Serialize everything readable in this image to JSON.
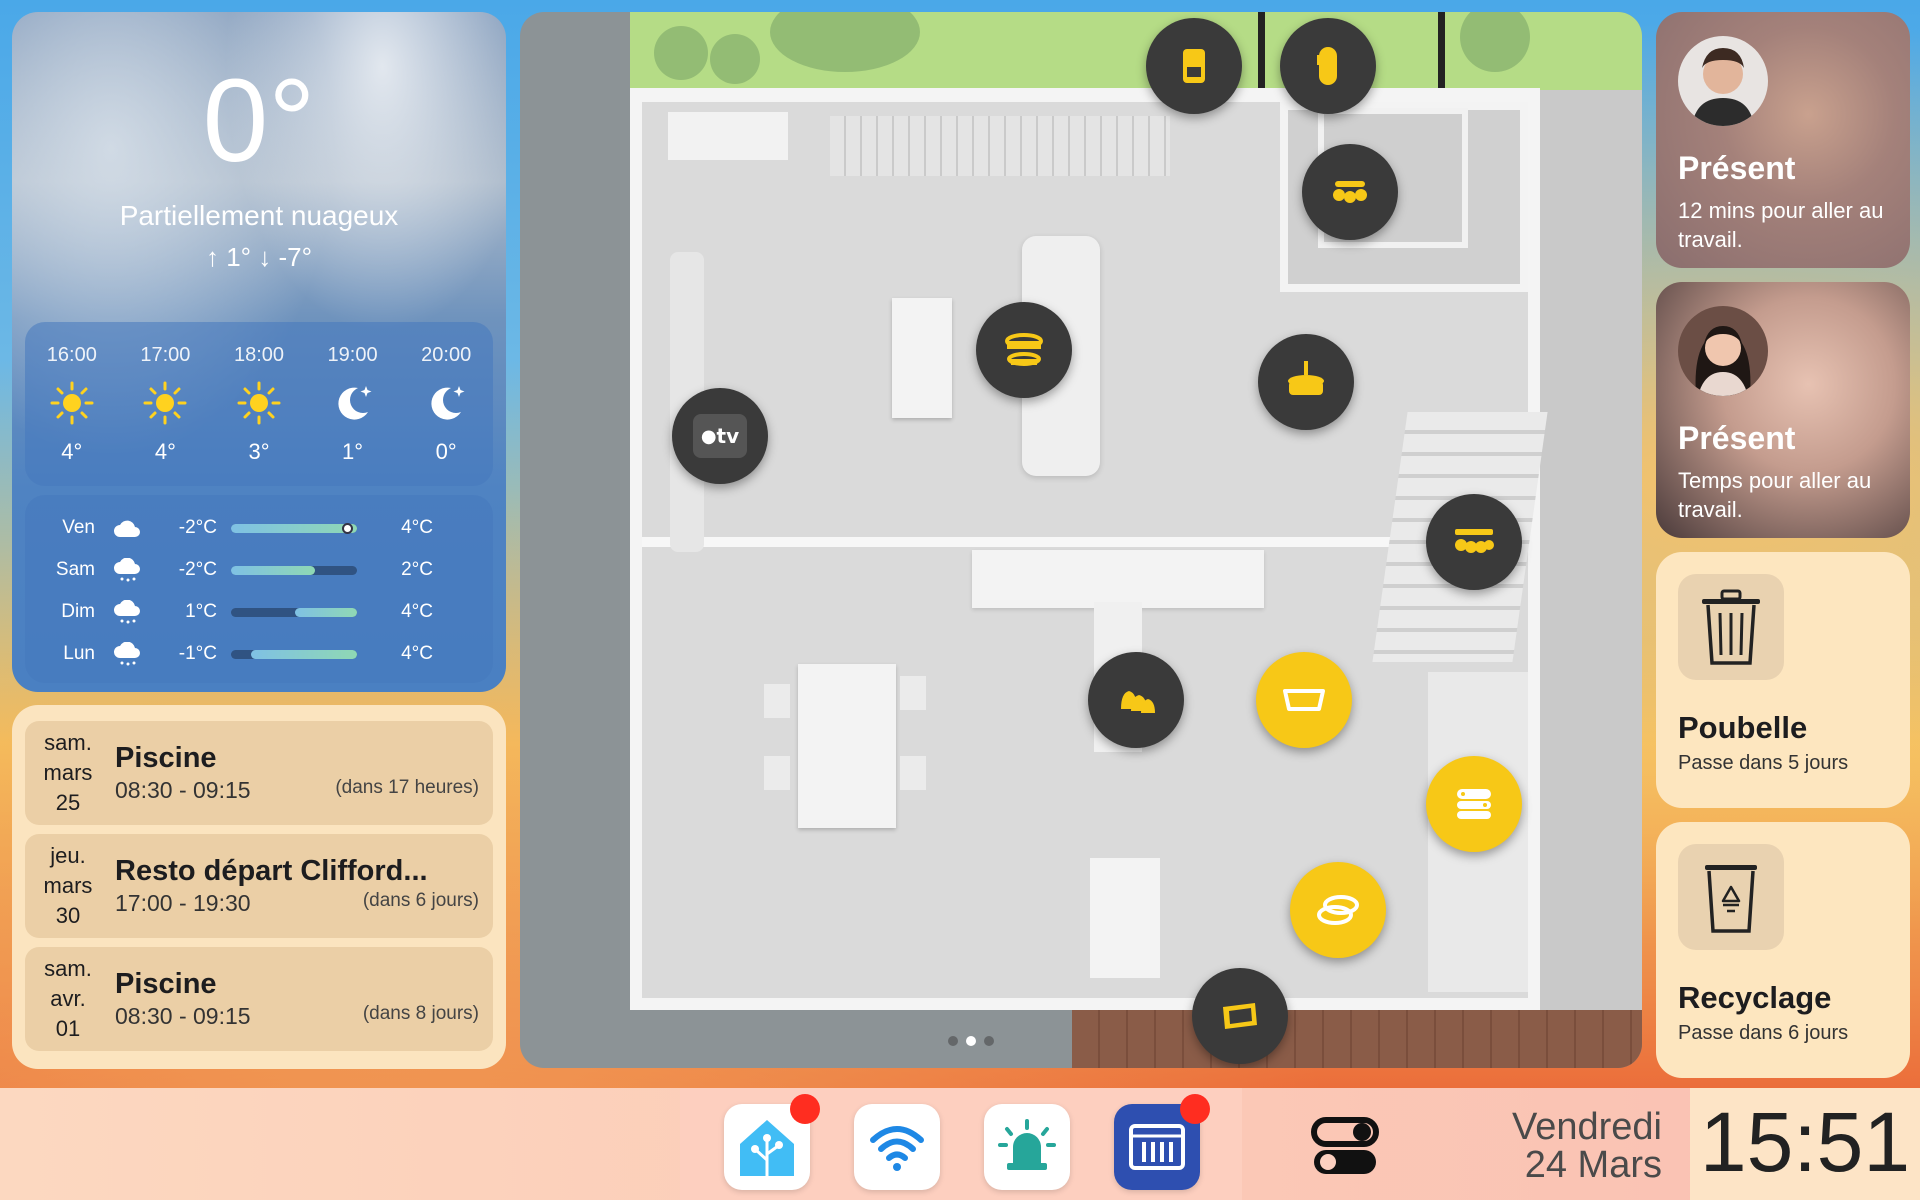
{
  "weather": {
    "temperature": "0°",
    "condition": "Partiellement nuageux",
    "high_low": "↑ 1° ↓ -7°",
    "hourly": [
      {
        "time": "16:00",
        "icon": "sun-icon",
        "temp": "4°"
      },
      {
        "time": "17:00",
        "icon": "sun-icon",
        "temp": "4°"
      },
      {
        "time": "18:00",
        "icon": "sun-icon",
        "temp": "3°"
      },
      {
        "time": "19:00",
        "icon": "moon-icon",
        "temp": "1°"
      },
      {
        "time": "20:00",
        "icon": "moon-icon",
        "temp": "0°"
      }
    ],
    "daily": [
      {
        "day": "Ven",
        "icon": "cloud-icon",
        "low": "-2°C",
        "high": "4°C"
      },
      {
        "day": "Sam",
        "icon": "cloud-snow-icon",
        "low": "-2°C",
        "high": "2°C"
      },
      {
        "day": "Dim",
        "icon": "cloud-snow-icon",
        "low": "1°C",
        "high": "4°C"
      },
      {
        "day": "Lun",
        "icon": "cloud-snow-icon",
        "low": "-1°C",
        "high": "4°C"
      }
    ]
  },
  "calendar": {
    "events": [
      {
        "date_line1": "sam.",
        "date_line2": "mars",
        "date_line3": "25",
        "title": "Piscine",
        "time": "08:30 - 09:15",
        "relative": "(dans 17 heures)"
      },
      {
        "date_line1": "jeu.",
        "date_line2": "mars",
        "date_line3": "30",
        "title": "Resto départ Clifford...",
        "time": "17:00 - 19:30",
        "relative": "(dans 6 jours)"
      },
      {
        "date_line1": "sam.",
        "date_line2": "avr.",
        "date_line3": "01",
        "title": "Piscine",
        "time": "08:30 - 09:15",
        "relative": "(dans 8 jours)"
      }
    ]
  },
  "floorplan": {
    "tv_label": "tv"
  },
  "people": [
    {
      "status": "Présent",
      "info": "12 mins pour aller au travail."
    },
    {
      "status": "Présent",
      "info": "Temps pour aller au travail."
    }
  ],
  "bins": [
    {
      "title": "Poubelle",
      "subtitle": "Passe dans 5 jours",
      "icon": "trash-icon"
    },
    {
      "title": "Recyclage",
      "subtitle": "Passe dans 6 jours",
      "icon": "recycle-bin-icon"
    }
  ],
  "bottom": {
    "day": "Vendredi",
    "date": "24 Mars",
    "time": "15:51"
  },
  "colors": {
    "light_on": "#f7c817",
    "light_off": "#3a3a3a",
    "badge": "#ff2d20"
  }
}
